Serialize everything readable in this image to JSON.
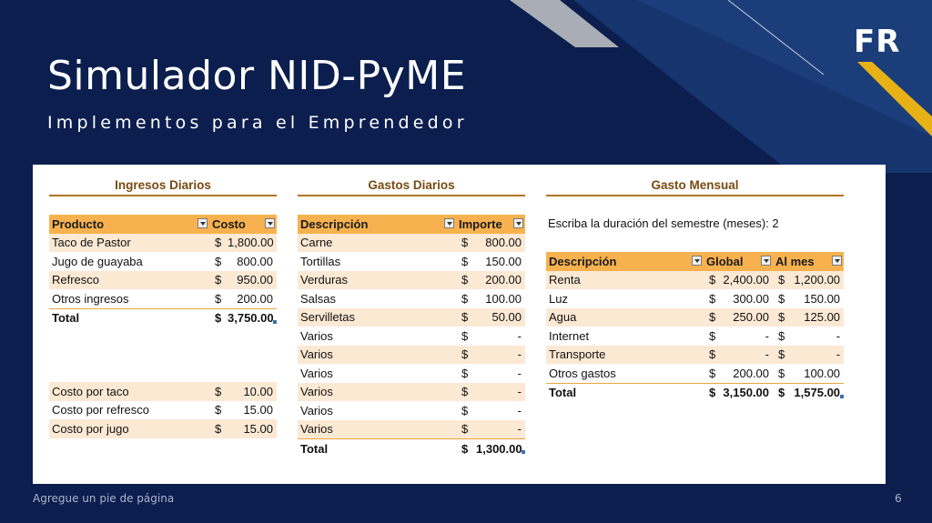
{
  "slide": {
    "title": "Simulador NID-PyME",
    "subtitle": "Implementos para el Emprendedor",
    "logo_text": "FR",
    "footer": "Agregue un pie de página",
    "page_number": "6",
    "colors": {
      "background": "#0c1e4e",
      "accent_yellow": "#e8b115",
      "header_orange": "#f7b24f",
      "band_peach": "#fce9d4"
    }
  },
  "ingresos": {
    "title": "Ingresos Diarios",
    "headers": [
      "Producto",
      "Costo"
    ],
    "rows": [
      {
        "label": "Taco de Pastor",
        "cur": "$",
        "value": "1,800.00"
      },
      {
        "label": "Jugo de guayaba",
        "cur": "$",
        "value": "800.00"
      },
      {
        "label": "Refresco",
        "cur": "$",
        "value": "950.00"
      },
      {
        "label": "Otros ingresos",
        "cur": "$",
        "value": "200.00"
      }
    ],
    "total": {
      "label": "Total",
      "cur": "$",
      "value": "3,750.00"
    },
    "costos": [
      {
        "label": "Costo por taco",
        "cur": "$",
        "value": "10.00"
      },
      {
        "label": "Costo por refresco",
        "cur": "$",
        "value": "15.00"
      },
      {
        "label": "Costo por jugo",
        "cur": "$",
        "value": "15.00"
      }
    ]
  },
  "gastos": {
    "title": "Gastos Diarios",
    "headers": [
      "Descripción",
      "Importe"
    ],
    "rows": [
      {
        "label": "Carne",
        "cur": "$",
        "value": "800.00"
      },
      {
        "label": "Tortillas",
        "cur": "$",
        "value": "150.00"
      },
      {
        "label": "Verduras",
        "cur": "$",
        "value": "200.00"
      },
      {
        "label": "Salsas",
        "cur": "$",
        "value": "100.00"
      },
      {
        "label": "Servilletas",
        "cur": "$",
        "value": "50.00"
      },
      {
        "label": "Varios",
        "cur": "$",
        "value": "-"
      },
      {
        "label": "Varios",
        "cur": "$",
        "value": "-"
      },
      {
        "label": "Varios",
        "cur": "$",
        "value": "-"
      },
      {
        "label": "Varios",
        "cur": "$",
        "value": "-"
      },
      {
        "label": "Varios",
        "cur": "$",
        "value": "-"
      },
      {
        "label": "Varios",
        "cur": "$",
        "value": "-"
      }
    ],
    "total": {
      "label": "Total",
      "cur": "$",
      "value": "1,300.00"
    }
  },
  "mensual": {
    "title": "Gasto Mensual",
    "note": "Escriba la duración del semestre (meses): 2",
    "headers": [
      "Descripción",
      "Global",
      "Al mes"
    ],
    "rows": [
      {
        "label": "Renta",
        "cur1": "$",
        "global": "2,400.00",
        "cur2": "$",
        "mes": "1,200.00"
      },
      {
        "label": "Luz",
        "cur1": "$",
        "global": "300.00",
        "cur2": "$",
        "mes": "150.00"
      },
      {
        "label": "Agua",
        "cur1": "$",
        "global": "250.00",
        "cur2": "$",
        "mes": "125.00"
      },
      {
        "label": "Internet",
        "cur1": "$",
        "global": "-",
        "cur2": "$",
        "mes": "-"
      },
      {
        "label": "Transporte",
        "cur1": "$",
        "global": "-",
        "cur2": "$",
        "mes": "-"
      },
      {
        "label": "Otros gastos",
        "cur1": "$",
        "global": "200.00",
        "cur2": "$",
        "mes": "100.00"
      }
    ],
    "total": {
      "label": "Total",
      "cur1": "$",
      "global": "3,150.00",
      "cur2": "$",
      "mes": "1,575.00"
    }
  }
}
